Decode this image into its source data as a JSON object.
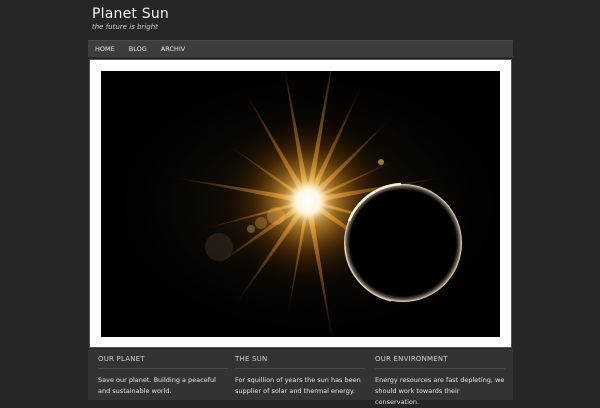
{
  "site": {
    "title": "Planet Sun",
    "tagline": "the future is bright"
  },
  "nav": {
    "items": [
      "HOME",
      "BLOG",
      "ARCHIV"
    ]
  },
  "slide": {
    "image_label": "sun-eclipse-image"
  },
  "footer": {
    "widgets": [
      {
        "title": "OUR PLANET",
        "text": "Save our planet. Building a peaceful and sustainable world."
      },
      {
        "title": "THE SUN",
        "text": "For squillion of years the sun has been supplier of solar and thermal energy."
      },
      {
        "title": "OUR ENVIRONMENT",
        "text": "Energy resources are fast depleting, we should work towards their conservation."
      }
    ]
  },
  "colors": {
    "background": "#262626",
    "nav": "#3d3d3d",
    "footer": "#333333",
    "sun_core": "#ffffff",
    "sun_glow": "#ff9c1a"
  }
}
